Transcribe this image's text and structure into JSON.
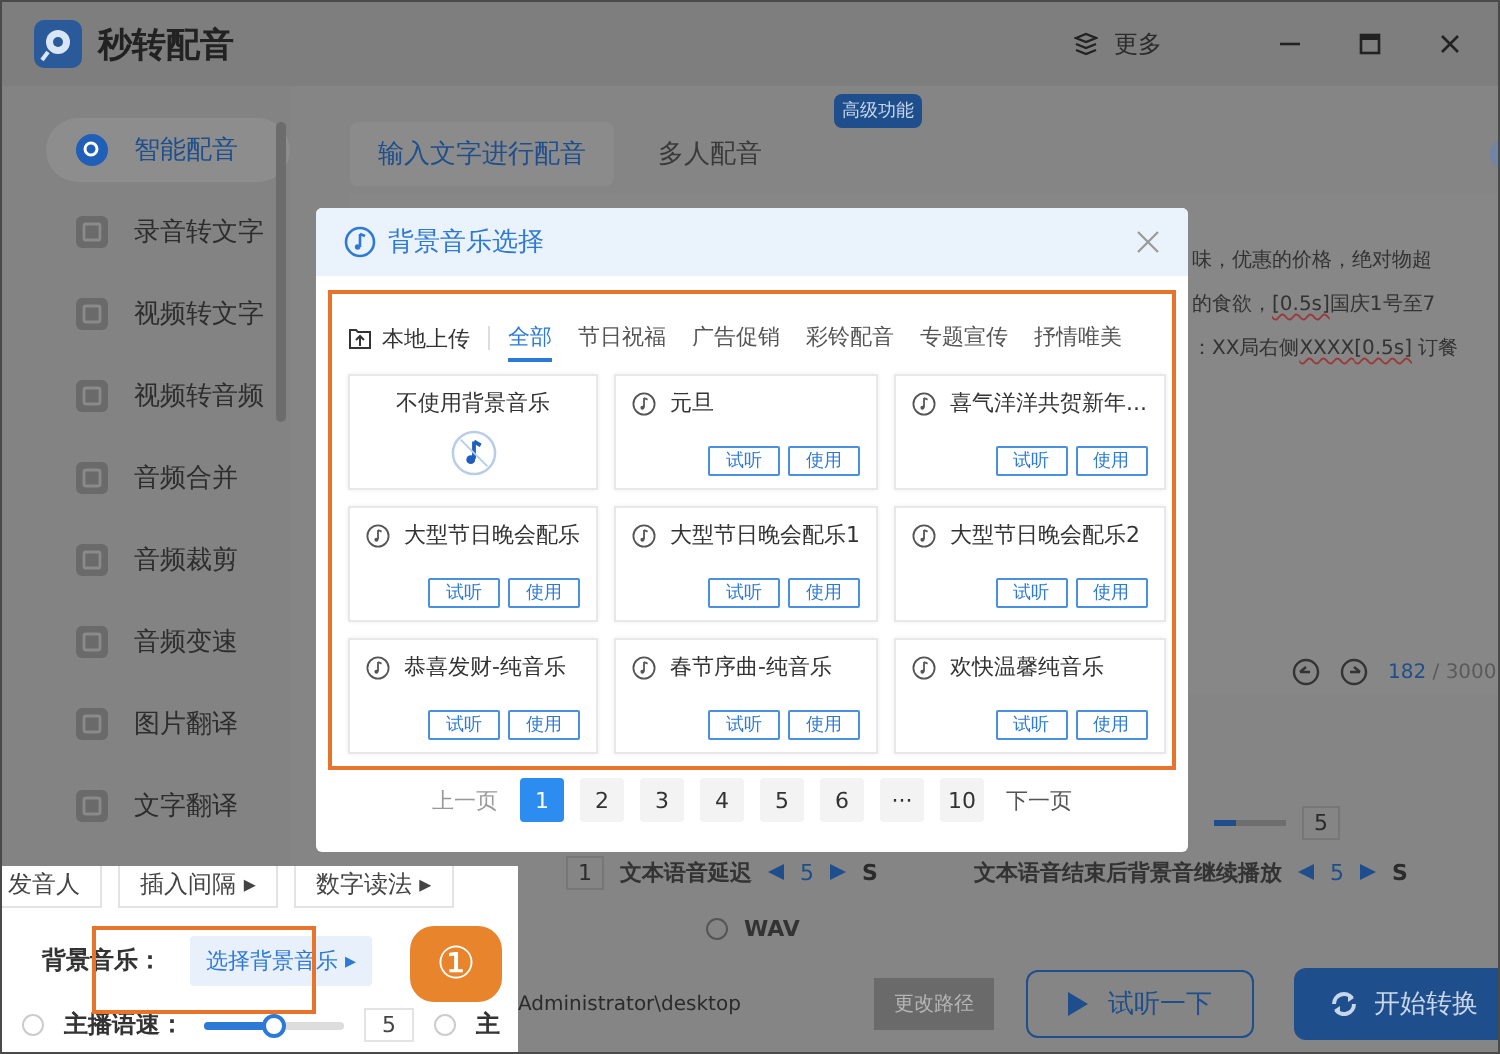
{
  "app": {
    "title": "秒转配音",
    "more": "更多"
  },
  "sidebar": {
    "items": [
      {
        "label": "智能配音",
        "selected": true
      },
      {
        "label": "录音转文字",
        "selected": false
      },
      {
        "label": "视频转文字",
        "selected": false
      },
      {
        "label": "视频转音频",
        "selected": false
      },
      {
        "label": "音频合并",
        "selected": false
      },
      {
        "label": "音频裁剪",
        "selected": false
      },
      {
        "label": "音频变速",
        "selected": false
      },
      {
        "label": "图片翻译",
        "selected": false
      },
      {
        "label": "文字翻译",
        "selected": false
      }
    ]
  },
  "main": {
    "tabs": [
      {
        "label": "输入文字进行配音",
        "selected": true
      },
      {
        "label": "多人配音",
        "selected": false
      }
    ],
    "badge": "高级功能",
    "text_lines": [
      [
        {
          "text": "味，优惠的价格，绝对物超",
          "marked": false
        }
      ],
      [
        {
          "text": "的食欲，",
          "marked": false
        },
        {
          "text": "[0.5s]",
          "marked": true
        },
        {
          "text": "国庆1号至7",
          "marked": false
        }
      ],
      [
        {
          "text": "：XX局右侧",
          "marked": false
        },
        {
          "text": "XXXX",
          "marked": true
        },
        {
          "text": "[0.5s]",
          "marked": true
        },
        {
          "text": " 订餐",
          "marked": false
        }
      ]
    ],
    "counter": {
      "current": "182",
      "total": "/ 3000"
    },
    "speed": {
      "level": 0.3,
      "value": "5"
    },
    "interval_value": "1",
    "delay": {
      "label": "文本语音延迟",
      "value": "5",
      "unit": "S"
    },
    "continue": {
      "label": "文本语音结束后背景音继续播放",
      "value": "5",
      "unit": "S"
    },
    "format": "WAV",
    "format_checked": false,
    "path": "Administrator\\desktop",
    "change_path": "更改路径",
    "preview_button": "试听一下",
    "convert_button": "开始转换"
  },
  "dialog": {
    "title": "背景音乐选择",
    "upload": "本地上传",
    "tabs": [
      {
        "label": "全部",
        "selected": true
      },
      {
        "label": "节日祝福",
        "selected": false
      },
      {
        "label": "广告促销",
        "selected": false
      },
      {
        "label": "彩铃配音",
        "selected": false
      },
      {
        "label": "专题宣传",
        "selected": false
      },
      {
        "label": "抒情唯美",
        "selected": false
      }
    ],
    "cards": [
      {
        "kind": "none",
        "title": "不使用背景音乐"
      },
      {
        "kind": "music",
        "title": "元旦",
        "preview": "试听",
        "use": "使用"
      },
      {
        "kind": "music",
        "title": "喜气洋洋共贺新年...",
        "preview": "试听",
        "use": "使用"
      },
      {
        "kind": "music",
        "title": "大型节日晚会配乐",
        "preview": "试听",
        "use": "使用"
      },
      {
        "kind": "music",
        "title": "大型节日晚会配乐1",
        "preview": "试听",
        "use": "使用"
      },
      {
        "kind": "music",
        "title": "大型节日晚会配乐2",
        "preview": "试听",
        "use": "使用"
      },
      {
        "kind": "music",
        "title": "恭喜发财-纯音乐",
        "preview": "试听",
        "use": "使用"
      },
      {
        "kind": "music",
        "title": "春节序曲-纯音乐",
        "preview": "试听",
        "use": "使用"
      },
      {
        "kind": "music",
        "title": "欢快温馨纯音乐",
        "preview": "试听",
        "use": "使用"
      }
    ],
    "pagination": {
      "prev": "上一页",
      "next": "下一页",
      "pages": [
        {
          "label": "1",
          "selected": true
        },
        {
          "label": "2",
          "selected": false
        },
        {
          "label": "3",
          "selected": false
        },
        {
          "label": "4",
          "selected": false
        },
        {
          "label": "5",
          "selected": false
        },
        {
          "label": "6",
          "selected": false
        },
        {
          "label": "···",
          "selected": false
        },
        {
          "label": "10",
          "selected": false
        }
      ]
    }
  },
  "inset": {
    "buttons": [
      "发音人",
      "插入间隔 ▸",
      "数字读法 ▸"
    ],
    "music_label": "背景音乐：",
    "music_button": "选择背景音乐 ▸",
    "speed_checked": false,
    "cut_checked": false,
    "speed_label": "主播语速：",
    "speed": {
      "level": 0.5,
      "value": "5"
    },
    "cut_label": "主",
    "step": "①"
  }
}
